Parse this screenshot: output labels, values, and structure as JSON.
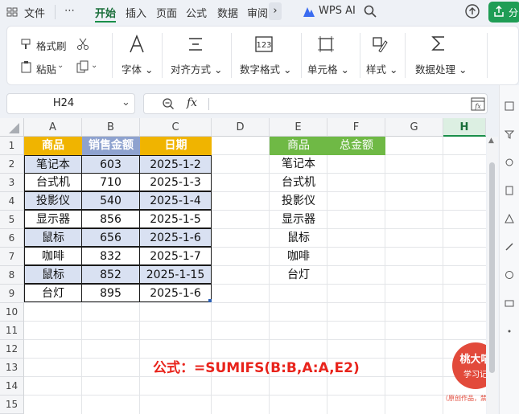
{
  "menubar": {
    "file": "文件",
    "more": "⋯",
    "tabs": [
      "开始",
      "插入",
      "页面",
      "公式",
      "数据",
      "审阅"
    ],
    "wps_ai": "WPS AI",
    "share": "分"
  },
  "ribbon": {
    "format_painter": "格式刷",
    "paste": "粘贴",
    "font": "字体",
    "align": "对齐方式",
    "number": "数字格式",
    "cell": "单元格",
    "style": "样式",
    "data_proc": "数据处理"
  },
  "formula_bar": {
    "cell_ref": "H24",
    "fx": "fx",
    "content": ""
  },
  "sheet": {
    "columns": [
      "A",
      "B",
      "C",
      "D",
      "E",
      "F",
      "G",
      "H"
    ],
    "rows": [
      "1",
      "2",
      "3",
      "4",
      "5",
      "6",
      "7",
      "8",
      "9",
      "10",
      "11",
      "12",
      "13",
      "14",
      "15"
    ],
    "table1_header": [
      "商品",
      "销售金额",
      "日期"
    ],
    "table1": [
      [
        "笔记本",
        "603",
        "2025-1-2"
      ],
      [
        "台式机",
        "710",
        "2025-1-3"
      ],
      [
        "投影仪",
        "540",
        "2025-1-4"
      ],
      [
        "显示器",
        "856",
        "2025-1-5"
      ],
      [
        "鼠标",
        "656",
        "2025-1-6"
      ],
      [
        "咖啡",
        "832",
        "2025-1-7"
      ],
      [
        "鼠标",
        "852",
        "2025-1-15"
      ],
      [
        "台灯",
        "895",
        "2025-1-6"
      ]
    ],
    "table2_header": [
      "商品",
      "总金额"
    ],
    "table2": [
      "笔记本",
      "台式机",
      "投影仪",
      "显示器",
      "鼠标",
      "咖啡",
      "台灯"
    ],
    "formula_note": "公式：=SUMIFS(B:B,A:A,E2)"
  },
  "watermark": {
    "name": "桃大喵",
    "sub": "学习记",
    "note": "（原创作品，禁止抄袭）"
  },
  "colors": {
    "header_orange": "#f0b400",
    "header_blue": "#8ea2cf",
    "header_green": "#6fb945",
    "row_shade": "#d9e1f2",
    "formula_red": "#e8231b",
    "accent_green": "#1a8f4a"
  }
}
